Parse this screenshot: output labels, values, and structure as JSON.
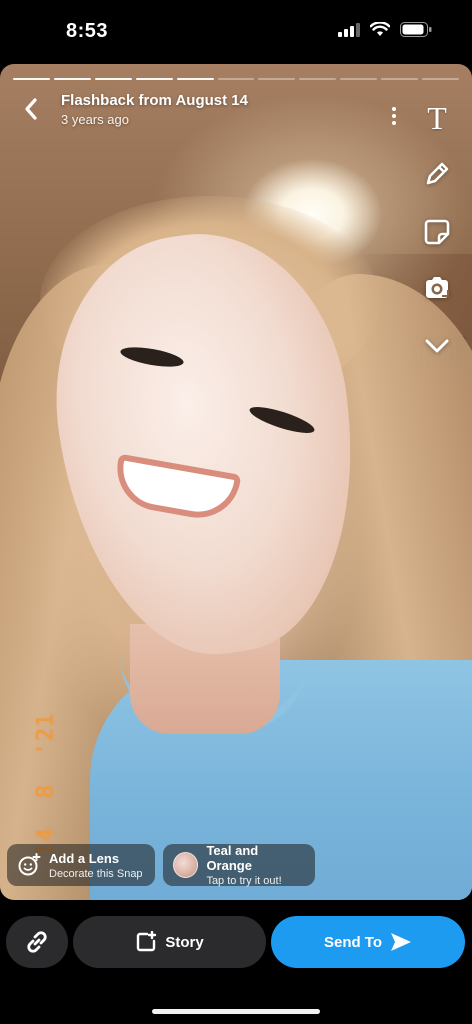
{
  "status_bar": {
    "time": "8:53"
  },
  "snap": {
    "progress_segments_total": 11,
    "progress_segments_done": 5,
    "title": "Flashback from August 14",
    "subtitle": "3 years ago",
    "date_stamp": "14  8  '21"
  },
  "tools": {
    "text": "T"
  },
  "lens_pills": {
    "lens_title": "Add a Lens",
    "lens_subtitle": "Decorate this Snap",
    "filter_title": "Teal and Orange",
    "filter_subtitle": "Tap to try it out!"
  },
  "bottom_bar": {
    "story_label": "Story",
    "send_label": "Send To"
  },
  "colors": {
    "send_button": "#1d9bf0",
    "date_stamp": "#f2993a",
    "dark_button": "#2b2b2d"
  }
}
